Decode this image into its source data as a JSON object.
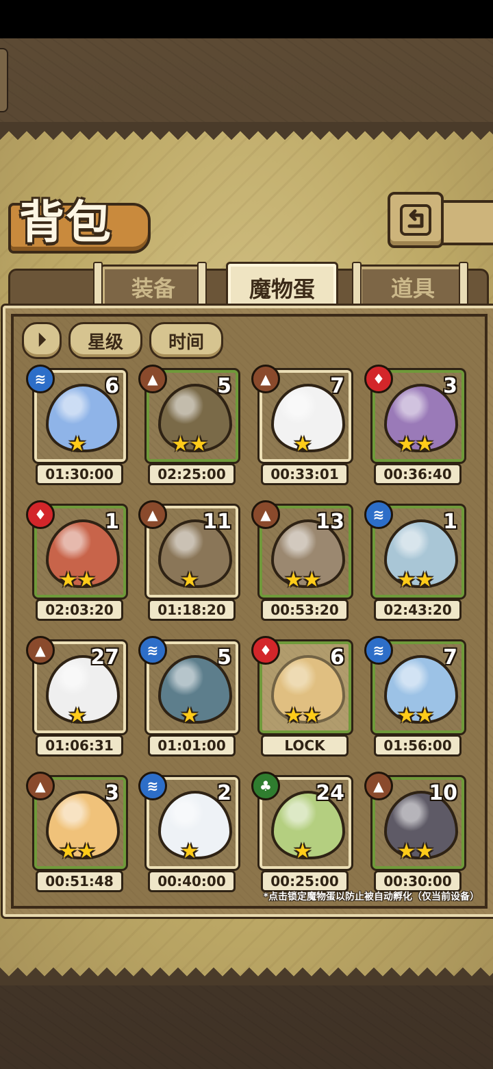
{
  "header": {
    "title": "背包"
  },
  "tabs": [
    {
      "label": "装备",
      "active": false
    },
    {
      "label": "魔物蛋",
      "active": true
    },
    {
      "label": "道具",
      "active": false
    }
  ],
  "sort": {
    "toggle_icon": "sort-toggle-icon",
    "star_label": "星级",
    "time_label": "时间"
  },
  "eggs": [
    {
      "element": "water",
      "count": "6",
      "stars": "★",
      "timer": "01:30:00",
      "color": "#8fb4e8",
      "frame": "light"
    },
    {
      "element": "earth",
      "count": "5",
      "stars": "★★",
      "timer": "02:25:00",
      "color": "#7a6a48",
      "frame": "green"
    },
    {
      "element": "earth",
      "count": "7",
      "stars": "★",
      "timer": "00:33:01",
      "color": "#f2f2f2",
      "frame": "light"
    },
    {
      "element": "fire",
      "count": "3",
      "stars": "★★",
      "timer": "00:36:40",
      "color": "#9a7ab8",
      "frame": "green"
    },
    {
      "element": "fire",
      "count": "1",
      "stars": "★★",
      "timer": "02:03:20",
      "color": "#c8644a",
      "frame": "green"
    },
    {
      "element": "earth",
      "count": "11",
      "stars": "★",
      "timer": "01:18:20",
      "color": "#8a7658",
      "frame": "light"
    },
    {
      "element": "earth",
      "count": "13",
      "stars": "★★",
      "timer": "00:53:20",
      "color": "#9b8870",
      "frame": "green"
    },
    {
      "element": "water",
      "count": "1",
      "stars": "★★",
      "timer": "02:43:20",
      "color": "#a9c6d6",
      "frame": "green"
    },
    {
      "element": "earth",
      "count": "27",
      "stars": "★",
      "timer": "01:06:31",
      "color": "#efefef",
      "frame": "light"
    },
    {
      "element": "water",
      "count": "5",
      "stars": "★",
      "timer": "01:01:00",
      "color": "#5d7e8c",
      "frame": "light"
    },
    {
      "element": "fire",
      "count": "6",
      "stars": "★★",
      "timer": "LOCK",
      "color": "#d8b070",
      "frame": "green",
      "locked": true
    },
    {
      "element": "water",
      "count": "7",
      "stars": "★★",
      "timer": "01:56:00",
      "color": "#9cc2e6",
      "frame": "green"
    },
    {
      "element": "earth",
      "count": "3",
      "stars": "★★",
      "timer": "00:51:48",
      "color": "#f0c27a",
      "frame": "green"
    },
    {
      "element": "water",
      "count": "2",
      "stars": "★",
      "timer": "00:40:00",
      "color": "#eef2f6",
      "frame": "light"
    },
    {
      "element": "wood",
      "count": "24",
      "stars": "★",
      "timer": "00:25:00",
      "color": "#b4cf80",
      "frame": "light"
    },
    {
      "element": "earth",
      "count": "10",
      "stars": "★★",
      "timer": "00:30:00",
      "color": "#5e5a66",
      "frame": "green"
    }
  ],
  "element_icons": {
    "water": "≋",
    "earth": "▲",
    "fire": "♦",
    "wood": "♣"
  },
  "footnote": "*点击锁定魔物蛋以防止被自动孵化（仅当前设备）"
}
